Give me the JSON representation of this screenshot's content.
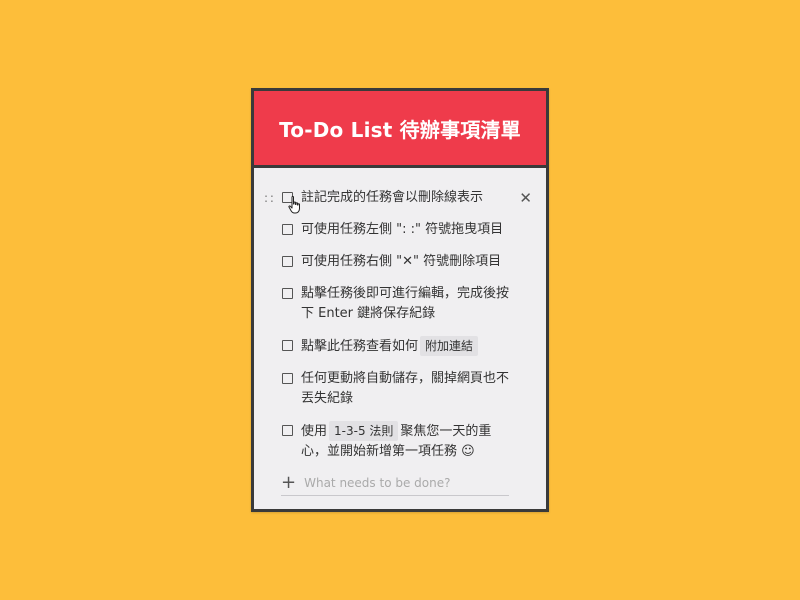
{
  "header": {
    "title": "To-Do List 待辦事項清單"
  },
  "items": [
    {
      "parts": [
        {
          "text": "註記完成的任務會以刪除線表示"
        }
      ]
    },
    {
      "parts": [
        {
          "text": "可使用任務左側 \": :\" 符號拖曳項目"
        }
      ]
    },
    {
      "parts": [
        {
          "text": "可使用任務右側 \"✕\" 符號刪除項目"
        }
      ]
    },
    {
      "parts": [
        {
          "text": "點擊任務後即可進行編輯，完成後按下 Enter 鍵將保存紀錄"
        }
      ]
    },
    {
      "parts": [
        {
          "text": "點擊此任務查看如何"
        },
        {
          "chip": "附加連結"
        }
      ]
    },
    {
      "parts": [
        {
          "text": "任何更動將自動儲存，關掉網頁也不丟失紀錄"
        }
      ]
    },
    {
      "parts": [
        {
          "text": "使用"
        },
        {
          "chip": "1-3-5 法則"
        },
        {
          "text": "聚焦您一天的重心，並開始新增第一項任務 ☺"
        }
      ]
    }
  ],
  "controls": {
    "drag_handle": ": :",
    "delete_symbol": "✕",
    "add_symbol": "+"
  },
  "new_task": {
    "value": "",
    "placeholder": "What needs to be done?"
  },
  "colors": {
    "background": "#FDBE3A",
    "header": "#EF3B4B",
    "card": "#F0EFF1",
    "border": "#3A3A3A"
  },
  "icons": {
    "drag": "drag-handle-icon",
    "delete": "close-icon",
    "add": "plus-icon",
    "cursor": "hand-pointer-icon"
  }
}
